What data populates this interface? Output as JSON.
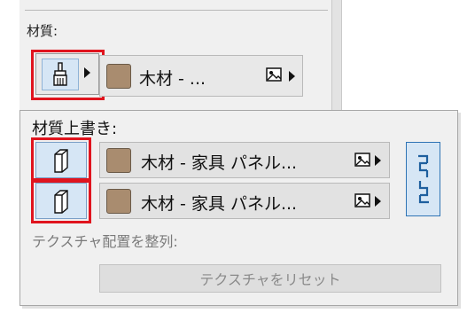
{
  "panel": {
    "section_label": "材質:"
  },
  "top_material": {
    "name": "木材 - ...",
    "swatch_color": "#a98c6f"
  },
  "override_popup": {
    "title": "材質上書き:",
    "rows": [
      {
        "name": "木材 - 家具 パネル..."
      },
      {
        "name": "木材 - 家具 パネル..."
      }
    ],
    "align_label": "テクスチャ配置を整列:",
    "reset_button": "テクスチャをリセット"
  },
  "colors": {
    "highlight": "#e0141e",
    "selected_bg": "#d6e6f5",
    "accent_border": "#2f74b5"
  },
  "icons": [
    "brush-icon",
    "image-icon",
    "object-icon",
    "chain-link-icon"
  ]
}
